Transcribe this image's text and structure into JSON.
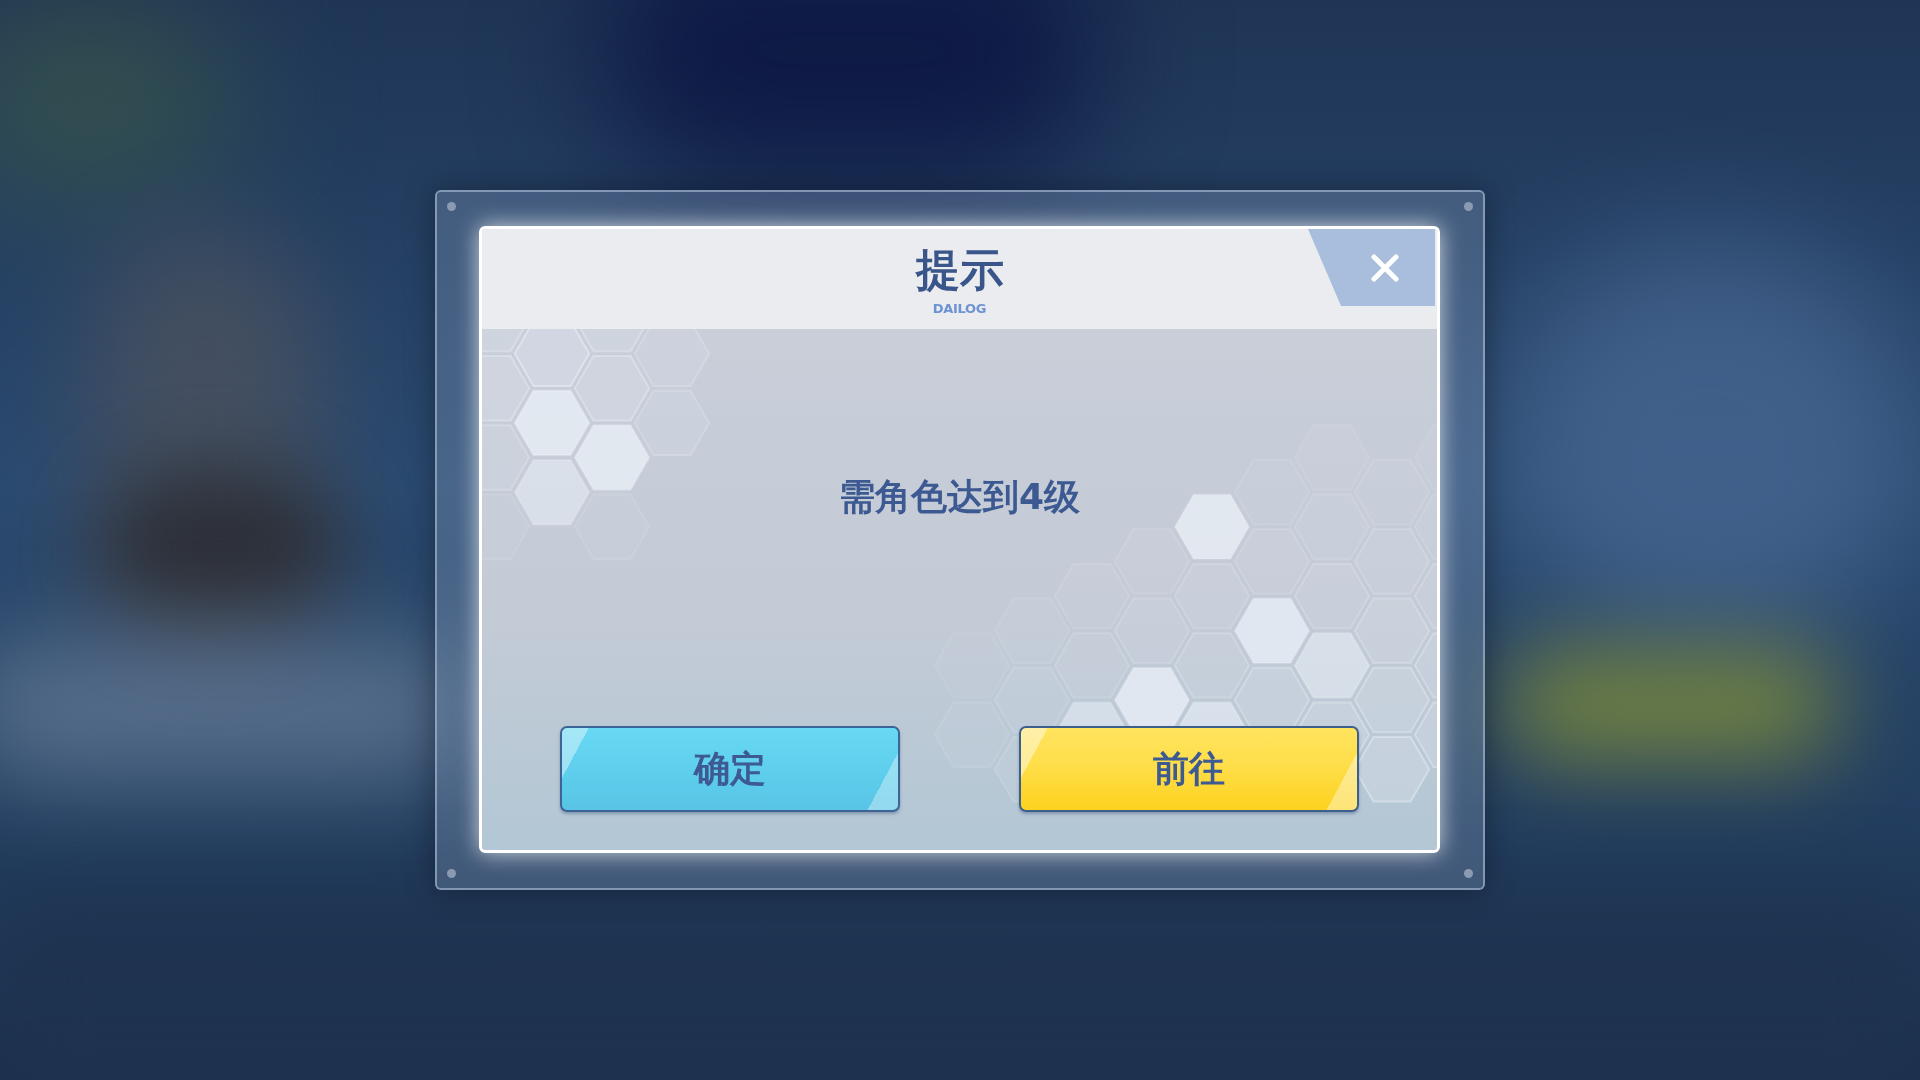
{
  "dialog": {
    "title": "提示",
    "subtitle": "DAILOG",
    "message": "需角色达到4级",
    "buttons": [
      {
        "label": "确定",
        "kind": "secondary"
      },
      {
        "label": "前往",
        "kind": "primary"
      }
    ]
  }
}
